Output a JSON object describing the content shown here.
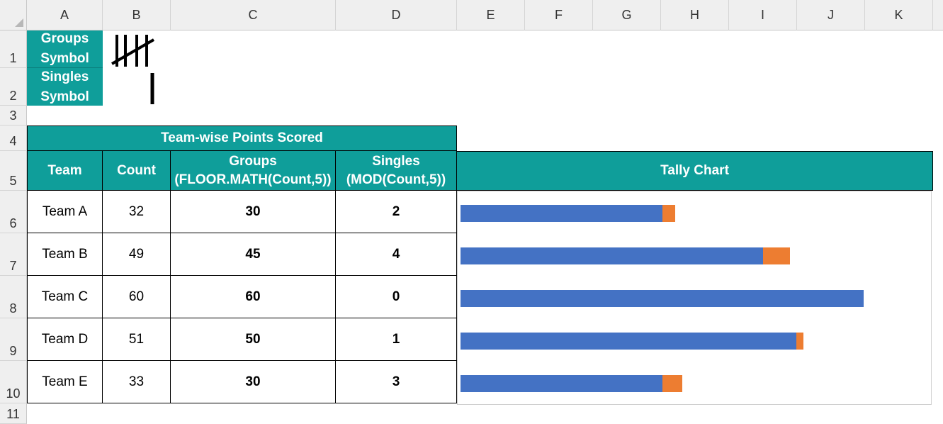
{
  "columns": [
    "A",
    "B",
    "C",
    "D",
    "E",
    "F",
    "G",
    "H",
    "I",
    "J",
    "K"
  ],
  "rows": [
    "1",
    "2",
    "3",
    "4",
    "5",
    "6",
    "7",
    "8",
    "9",
    "10",
    "11"
  ],
  "symbols": {
    "groups_label": [
      "Groups",
      "Symbol"
    ],
    "singles_label": [
      "Singles",
      "Symbol"
    ]
  },
  "table": {
    "title": "Team-wise Points Scored",
    "headers": {
      "team": "Team",
      "count": "Count",
      "groups_line1": "Groups",
      "groups_line2": "(FLOOR.MATH(Count,5))",
      "singles_line1": "Singles",
      "singles_line2": "(MOD(Count,5))"
    },
    "rows": [
      {
        "team": "Team A",
        "count": "32",
        "groups": "30",
        "singles": "2"
      },
      {
        "team": "Team B",
        "count": "49",
        "groups": "45",
        "singles": "4"
      },
      {
        "team": "Team C",
        "count": "60",
        "groups": "60",
        "singles": "0"
      },
      {
        "team": "Team D",
        "count": "51",
        "groups": "50",
        "singles": "1"
      },
      {
        "team": "Team E",
        "count": "33",
        "groups": "30",
        "singles": "3"
      }
    ]
  },
  "chart_header": "Tally Chart",
  "colors": {
    "header_teal": "#0f9e9a",
    "groups_bar": "#4472c4",
    "singles_bar": "#ed7d31"
  },
  "chart_data": {
    "type": "bar",
    "orientation": "horizontal",
    "stacked": true,
    "categories": [
      "Team A",
      "Team B",
      "Team C",
      "Team D",
      "Team E"
    ],
    "series": [
      {
        "values": [
          30,
          45,
          60,
          50,
          30
        ]
      },
      {
        "values": [
          2,
          4,
          0,
          1,
          3
        ]
      }
    ],
    "xlim": [
      0,
      60
    ]
  }
}
